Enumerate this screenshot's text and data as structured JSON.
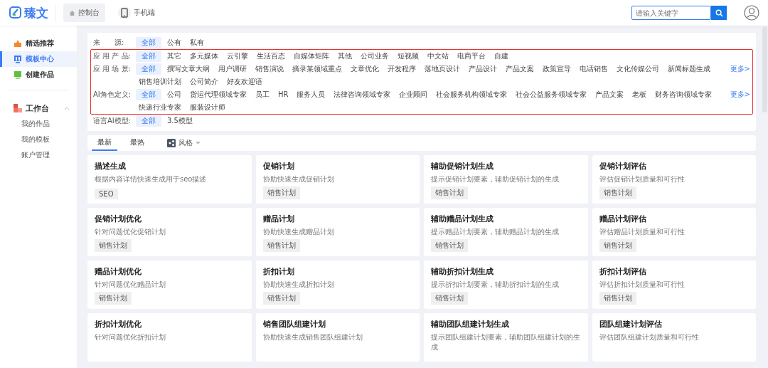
{
  "header": {
    "logo": "臻文",
    "nav": [
      {
        "label": "控制台",
        "kind": "home",
        "selected": true
      },
      {
        "label": "手机端",
        "kind": "phone",
        "selected": false
      }
    ],
    "search": {
      "placeholder": "请输入关键字"
    }
  },
  "sidebar": {
    "items": [
      {
        "label": "精选推荐",
        "kind": "star",
        "selected": false
      },
      {
        "label": "模板中心",
        "kind": "template",
        "selected": true
      },
      {
        "label": "创建作品",
        "kind": "create",
        "selected": false
      }
    ],
    "workspace": {
      "label": "工作台",
      "expanded": true,
      "children": [
        {
          "label": "我的作品"
        },
        {
          "label": "我的模板"
        },
        {
          "label": "账户管理"
        }
      ]
    }
  },
  "filters": [
    {
      "label": "来　　源:",
      "highlighted": false,
      "options": [
        {
          "label": "全部",
          "selected": true
        },
        {
          "label": "公有",
          "selected": false
        },
        {
          "label": "私有",
          "selected": false
        }
      ]
    },
    {
      "label": "应 用 产 品:",
      "highlighted": true,
      "options": [
        {
          "label": "全部",
          "selected": true
        },
        {
          "label": "其它",
          "selected": false
        },
        {
          "label": "多元媒体",
          "selected": false
        },
        {
          "label": "云引擎",
          "selected": false
        },
        {
          "label": "生活百态",
          "selected": false
        },
        {
          "label": "自媒体矩阵",
          "selected": false
        },
        {
          "label": "其他",
          "selected": false
        },
        {
          "label": "公司业务",
          "selected": false
        },
        {
          "label": "短视频",
          "selected": false
        },
        {
          "label": "中文站",
          "selected": false
        },
        {
          "label": "电商平台",
          "selected": false
        },
        {
          "label": "自建",
          "selected": false
        }
      ]
    },
    {
      "label": "应 用 场 景:",
      "highlighted": true,
      "more": "更多>",
      "options": [
        {
          "label": "全部",
          "selected": true
        },
        {
          "label": "撰写文章大纲",
          "selected": false
        },
        {
          "label": "用户调研",
          "selected": false
        },
        {
          "label": "销售演说",
          "selected": false
        },
        {
          "label": "摘录某领域重点",
          "selected": false
        },
        {
          "label": "文章优化",
          "selected": false
        },
        {
          "label": "开发程序",
          "selected": false
        },
        {
          "label": "落地页设计",
          "selected": false
        },
        {
          "label": "产品设计",
          "selected": false
        },
        {
          "label": "产品文案",
          "selected": false
        },
        {
          "label": "政策宣导",
          "selected": false
        },
        {
          "label": "电话销售",
          "selected": false
        },
        {
          "label": "文化传媒公司",
          "selected": false
        },
        {
          "label": "新闻标题生成",
          "selected": false
        },
        {
          "label": "销售培训计划",
          "selected": false
        },
        {
          "label": "公司简介",
          "selected": false
        },
        {
          "label": "好友欢迎语",
          "selected": false
        }
      ]
    },
    {
      "label": "AI角色定义:",
      "highlighted": true,
      "more": "更多>",
      "options": [
        {
          "label": "全部",
          "selected": true
        },
        {
          "label": "公司",
          "selected": false
        },
        {
          "label": "货运代理领域专家",
          "selected": false
        },
        {
          "label": "员工",
          "selected": false
        },
        {
          "label": "HR",
          "selected": false
        },
        {
          "label": "服务人员",
          "selected": false
        },
        {
          "label": "法律咨询领域专家",
          "selected": false
        },
        {
          "label": "企业顾问",
          "selected": false
        },
        {
          "label": "社会服务机构领域专家",
          "selected": false
        },
        {
          "label": "社会公益服务领域专家",
          "selected": false
        },
        {
          "label": "产品文案",
          "selected": false
        },
        {
          "label": "老板",
          "selected": false
        },
        {
          "label": "财务咨询领域专家",
          "selected": false
        },
        {
          "label": "快递行业专家",
          "selected": false
        },
        {
          "label": "服装设计师",
          "selected": false
        }
      ]
    },
    {
      "label": "语言AI模型:",
      "highlighted": false,
      "options": [
        {
          "label": "全部",
          "selected": true
        },
        {
          "label": "3.5模型",
          "selected": false
        }
      ]
    }
  ],
  "tabs": [
    {
      "label": "最新",
      "selected": true
    },
    {
      "label": "最热",
      "selected": false
    }
  ],
  "style_dropdown": {
    "label": "风格"
  },
  "cards": [
    {
      "title": "描述生成",
      "desc": "根据内容详情快速生成用于seo描述",
      "tag": "SEO"
    },
    {
      "title": "促销计划",
      "desc": "协助快速生成促销计划",
      "tag": "销售计划"
    },
    {
      "title": "辅助促销计划生成",
      "desc": "提示促销计划要素，辅助促销计划的生成",
      "tag": "销售计划"
    },
    {
      "title": "促销计划评估",
      "desc": "评估促销计划质量和可行性",
      "tag": "销售计划"
    },
    {
      "title": "促销计划优化",
      "desc": "针对问题优化促销计划",
      "tag": "销售计划"
    },
    {
      "title": "赠品计划",
      "desc": "协助快速生成赠品计划",
      "tag": "销售计划"
    },
    {
      "title": "辅助赠品计划生成",
      "desc": "提示赠品计划要素，辅助赠品计划的生成",
      "tag": "销售计划"
    },
    {
      "title": "赠品计划评估",
      "desc": "评估赠品计划质量和可行性",
      "tag": "销售计划"
    },
    {
      "title": "赠品计划优化",
      "desc": "针对问题优化赠品计划",
      "tag": "销售计划"
    },
    {
      "title": "折扣计划",
      "desc": "协助快速生成折扣计划",
      "tag": "销售计划"
    },
    {
      "title": "辅助折扣计划生成",
      "desc": "提示折扣计划要素，辅助折扣计划的生成",
      "tag": "销售计划"
    },
    {
      "title": "折扣计划评估",
      "desc": "评估折扣计划质量和可行性",
      "tag": "销售计划"
    },
    {
      "title": "折扣计划优化",
      "desc": "针对问题优化折扣计划"
    },
    {
      "title": "销售团队组建计划",
      "desc": "协助快速生成销售团队组建计划"
    },
    {
      "title": "辅助团队组建计划生成",
      "desc": "提示团队组建计划要素，辅助团队组建计划的生成"
    },
    {
      "title": "团队组建计划评估",
      "desc": "评估团队组建计划质量和可行性"
    }
  ]
}
